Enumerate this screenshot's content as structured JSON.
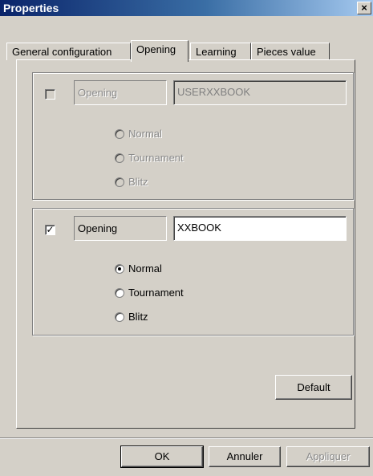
{
  "window": {
    "title": "Properties",
    "close_glyph": "×"
  },
  "tabs": [
    {
      "label": "General configuration"
    },
    {
      "label": "Opening",
      "active": true
    },
    {
      "label": "Learning"
    },
    {
      "label": "Pieces value"
    }
  ],
  "opening1": {
    "checked": false,
    "enabled": false,
    "label": "Opening",
    "value": "USERXXBOOK",
    "radios": [
      {
        "label": "Normal",
        "selected": false
      },
      {
        "label": "Tournament",
        "selected": false
      },
      {
        "label": "Blitz",
        "selected": false
      }
    ]
  },
  "opening2": {
    "checked": true,
    "enabled": true,
    "label": "Opening",
    "value": "XXBOOK",
    "radios": [
      {
        "label": "Normal",
        "selected": true
      },
      {
        "label": "Tournament",
        "selected": false
      },
      {
        "label": "Blitz",
        "selected": false
      }
    ]
  },
  "buttons": {
    "default_label": "Default",
    "ok_label": "OK",
    "cancel_label": "Annuler",
    "apply_label": "Appliquer"
  },
  "icons": {
    "checkmark": "check-mark-icon"
  },
  "colors": {
    "titlebar_start": "#0a246a",
    "titlebar_end": "#a6caf0",
    "face": "#d4d0c8"
  }
}
